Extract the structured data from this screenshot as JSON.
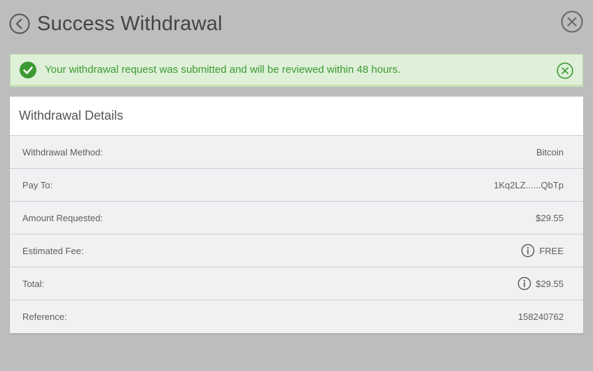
{
  "header": {
    "title": "Success Withdrawal",
    "back_icon": "chevron-left-circle-icon",
    "close_icon": "close-circle-icon"
  },
  "alert": {
    "message": "Your withdrawal request was submitted and will be reviewed within 48 hours.",
    "icon": "check-circle-icon",
    "close_icon": "close-circle-icon",
    "color": "#3c9a34",
    "background": "#dff0d8"
  },
  "details": {
    "title": "Withdrawal Details",
    "rows": [
      {
        "label": "Withdrawal Method:",
        "value": "Bitcoin"
      },
      {
        "label": "Pay To:",
        "value": "1Kq2LZ......QbTp"
      },
      {
        "label": "Amount Requested:",
        "value": "$29.55"
      },
      {
        "label": "Estimated Fee:",
        "value": "FREE",
        "icon": "info-icon"
      },
      {
        "label": "Total:",
        "value": "$29.55",
        "icon": "info-icon"
      },
      {
        "label": "Reference:",
        "value": "158240762"
      }
    ]
  }
}
